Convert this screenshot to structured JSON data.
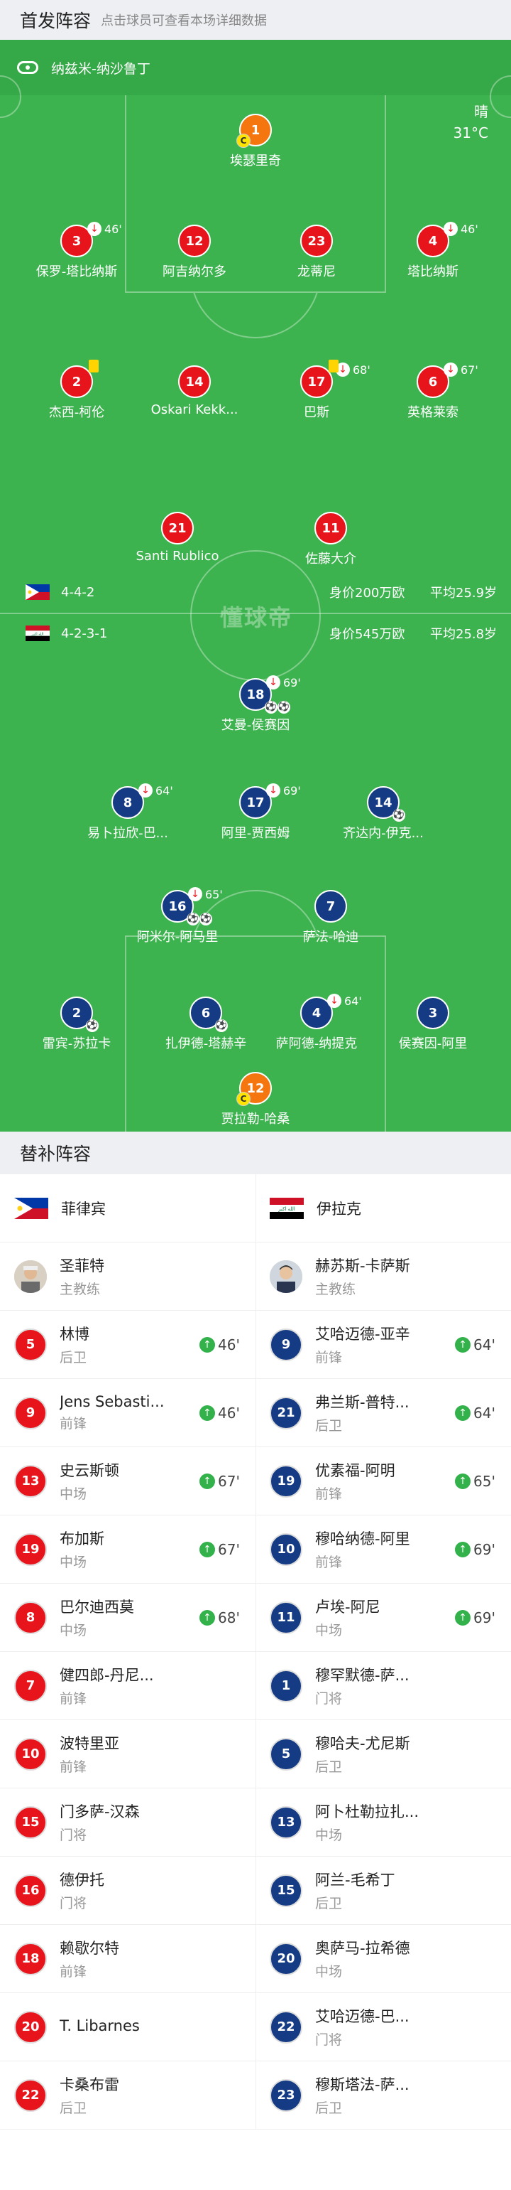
{
  "header": {
    "title": "首发阵容",
    "hint": "点击球员可查看本场详细数据"
  },
  "venue": {
    "icon": "stadium-icon",
    "name": "纳兹米-纳沙鲁丁"
  },
  "weather": {
    "condition": "晴",
    "temp": "31°C"
  },
  "watermark": "懂球帝",
  "home_team": {
    "formation": "4-4-2",
    "value": "身价200万欧",
    "avg_age": "平均25.9岁",
    "flag": "philippines-flag"
  },
  "away_team": {
    "formation": "4-2-3-1",
    "value": "身价545万欧",
    "avg_age": "平均25.8岁",
    "flag": "iraq-flag"
  },
  "home_lineup": [
    {
      "num": "1",
      "name": "埃瑟里奇",
      "captain": "C"
    },
    {
      "num": "3",
      "name": "保罗-塔比纳斯",
      "sub": "46'"
    },
    {
      "num": "12",
      "name": "阿吉纳尔多"
    },
    {
      "num": "23",
      "name": "龙蒂尼"
    },
    {
      "num": "4",
      "name": "塔比纳斯",
      "sub": "46'"
    },
    {
      "num": "2",
      "name": "杰西-柯伦"
    },
    {
      "num": "14",
      "name": "Oskari Kekk..."
    },
    {
      "num": "17",
      "name": "巴斯",
      "sub": "68'"
    },
    {
      "num": "6",
      "name": "英格莱索",
      "sub": "67'"
    },
    {
      "num": "21",
      "name": "Santi Rublico"
    },
    {
      "num": "11",
      "name": "佐藤大介"
    }
  ],
  "away_lineup": [
    {
      "num": "18",
      "name": "艾曼-侯赛因",
      "sub": "69'"
    },
    {
      "num": "8",
      "name": "易卜拉欣-巴...",
      "sub": "64'"
    },
    {
      "num": "17",
      "name": "阿里-贾西姆",
      "sub": "69'"
    },
    {
      "num": "14",
      "name": "齐达内-伊克..."
    },
    {
      "num": "16",
      "name": "阿米尔-阿马里",
      "sub": "65'"
    },
    {
      "num": "7",
      "name": "萨法-哈迪"
    },
    {
      "num": "2",
      "name": "雷宾-苏拉卡"
    },
    {
      "num": "6",
      "name": "扎伊德-塔赫辛"
    },
    {
      "num": "4",
      "name": "萨阿德-纳提克",
      "sub": "64'"
    },
    {
      "num": "3",
      "name": "侯赛因-阿里"
    },
    {
      "num": "12",
      "name": "贾拉勒-哈桑",
      "captain": "C"
    }
  ],
  "bench": {
    "title": "替补阵容",
    "home": {
      "team": "菲律宾",
      "coach": {
        "name": "圣菲特",
        "role": "主教练"
      },
      "players": [
        {
          "num": "5",
          "name": "林博",
          "pos": "后卫",
          "min": "46'"
        },
        {
          "num": "9",
          "name": "Jens Sebasti...",
          "pos": "前锋",
          "min": "46'"
        },
        {
          "num": "13",
          "name": "史云斯顿",
          "pos": "中场",
          "min": "67'"
        },
        {
          "num": "19",
          "name": "布加斯",
          "pos": "中场",
          "min": "67'"
        },
        {
          "num": "8",
          "name": "巴尔迪西莫",
          "pos": "中场",
          "min": "68'"
        },
        {
          "num": "7",
          "name": "健四郎-丹尼...",
          "pos": "前锋"
        },
        {
          "num": "10",
          "name": "波特里亚",
          "pos": "前锋"
        },
        {
          "num": "15",
          "name": "门多萨-汉森",
          "pos": "门将"
        },
        {
          "num": "16",
          "name": "德伊托",
          "pos": "门将"
        },
        {
          "num": "18",
          "name": "赖歇尔特",
          "pos": "前锋"
        },
        {
          "num": "20",
          "name": "T. Libarnes",
          "pos": ""
        },
        {
          "num": "22",
          "name": "卡桑布雷",
          "pos": "后卫"
        }
      ]
    },
    "away": {
      "team": "伊拉克",
      "coach": {
        "name": "赫苏斯-卡萨斯",
        "role": "主教练"
      },
      "players": [
        {
          "num": "9",
          "name": "艾哈迈德-亚辛",
          "pos": "前锋",
          "min": "64'"
        },
        {
          "num": "21",
          "name": "弗兰斯-普特...",
          "pos": "后卫",
          "min": "64'"
        },
        {
          "num": "19",
          "name": "优素福-阿明",
          "pos": "前锋",
          "min": "65'"
        },
        {
          "num": "10",
          "name": "穆哈纳德-阿里",
          "pos": "前锋",
          "min": "69'"
        },
        {
          "num": "11",
          "name": "卢埃-阿尼",
          "pos": "中场",
          "min": "69'"
        },
        {
          "num": "1",
          "name": "穆罕默德-萨...",
          "pos": "门将"
        },
        {
          "num": "5",
          "name": "穆哈夫-尤尼斯",
          "pos": "后卫"
        },
        {
          "num": "13",
          "name": "阿卜杜勒拉扎...",
          "pos": "中场"
        },
        {
          "num": "15",
          "name": "阿兰-毛希丁",
          "pos": "后卫"
        },
        {
          "num": "20",
          "name": "奥萨马-拉希德",
          "pos": "中场"
        },
        {
          "num": "22",
          "name": "艾哈迈德-巴...",
          "pos": "门将"
        },
        {
          "num": "23",
          "name": "穆斯塔法-萨...",
          "pos": "后卫"
        }
      ]
    }
  }
}
